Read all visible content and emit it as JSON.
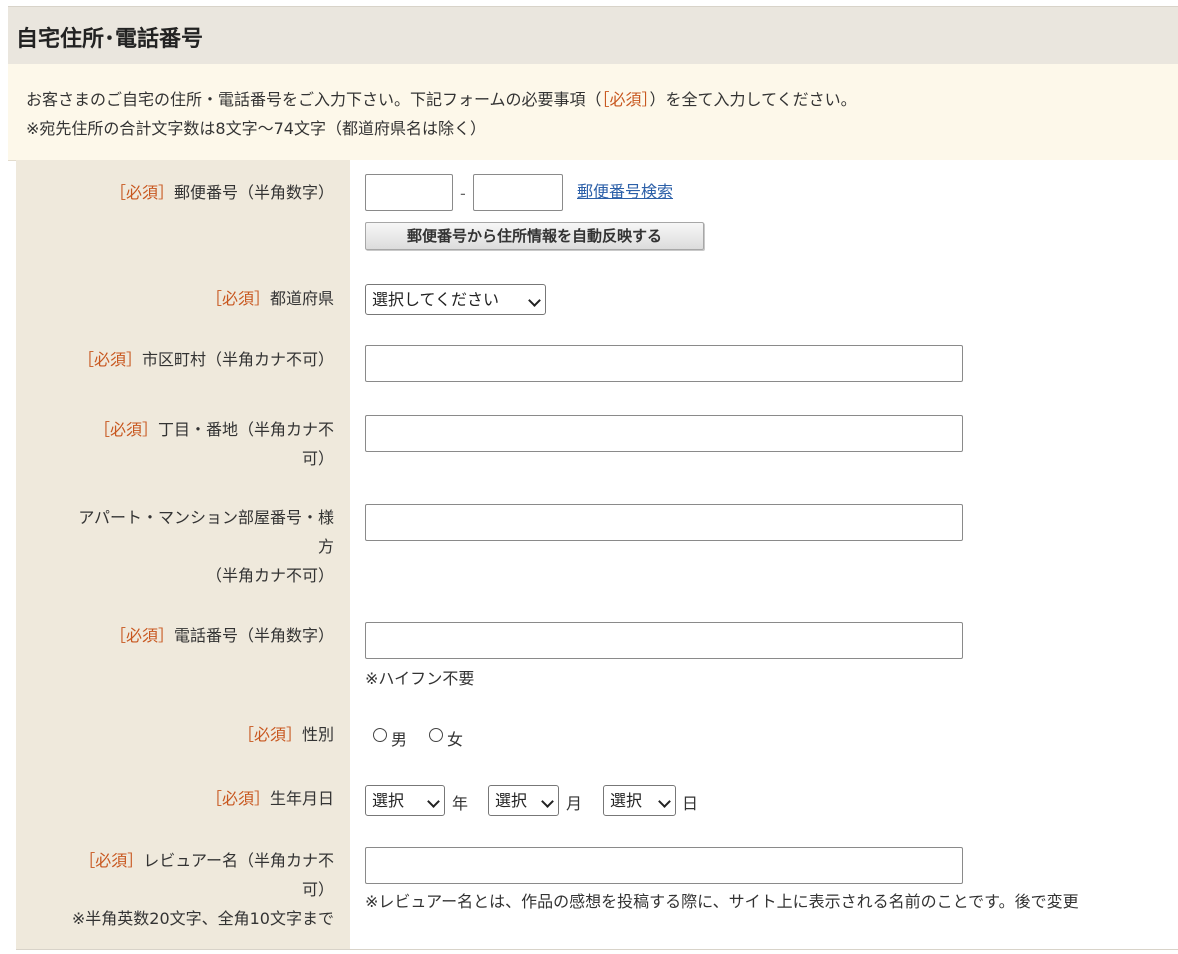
{
  "header": {
    "title": "自宅住所･電話番号"
  },
  "intro": {
    "line1_a": "お客さまのご自宅の住所・電話番号をご入力下さい。下記フォームの必要事項（",
    "line1_req": "［必須］",
    "line1_b": "）を全て入力してください。",
    "line2": "※宛先住所の合計文字数は8文字～74文字（都道府県名は除く）"
  },
  "required_tag": "［必須］",
  "fields": {
    "postal": {
      "label": "郵便番号（半角数字）",
      "separator": "-",
      "search_link": "郵便番号検索",
      "autofill_button": "郵便番号から住所情報を自動反映する",
      "value1": "",
      "value2": ""
    },
    "prefecture": {
      "label": "都道府県",
      "selected": "選択してください"
    },
    "city": {
      "label": "市区町村（半角カナ不可）",
      "value": ""
    },
    "street": {
      "label_l1": "丁目・番地（半角カナ不",
      "label_l2": "可）",
      "value": ""
    },
    "building": {
      "label_l1": "アパート・マンション部屋番号・様",
      "label_l2": "方",
      "label_l3": "（半角カナ不可）",
      "value": ""
    },
    "phone": {
      "label": "電話番号（半角数字）",
      "note": "※ハイフン不要",
      "value": ""
    },
    "gender": {
      "label": "性別",
      "option_male": "男",
      "option_female": "女"
    },
    "birthday": {
      "label": "生年月日",
      "year_selected": "選択",
      "year_unit": "年",
      "month_selected": "選択",
      "month_unit": "月",
      "day_selected": "選択",
      "day_unit": "日"
    },
    "reviewer": {
      "label_l1": "レビュアー名（半角カナ不",
      "label_l2": "可）",
      "label_l3": "※半角英数20文字、全角10文字まで",
      "note": "※レビュアー名とは、作品の感想を投稿する際に、サイト上に表示される名前のことです。後で変更",
      "value": ""
    }
  }
}
